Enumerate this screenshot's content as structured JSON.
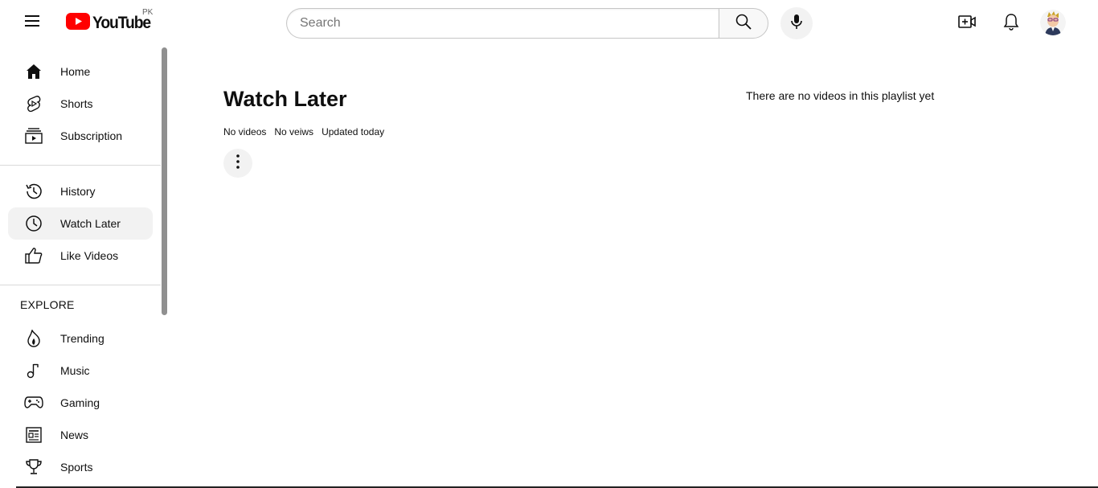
{
  "header": {
    "logo_text": "YouTube",
    "country_code": "PK",
    "search_placeholder": "Search",
    "icons": [
      "menu-icon",
      "search-icon",
      "mic-icon",
      "create-video-icon",
      "bell-icon"
    ]
  },
  "sidebar": {
    "section1": [
      {
        "label": "Home",
        "icon": "home-icon"
      },
      {
        "label": "Shorts",
        "icon": "shorts-icon"
      },
      {
        "label": "Subscription",
        "icon": "subscriptions-icon"
      }
    ],
    "section2": [
      {
        "label": "History",
        "icon": "history-icon"
      },
      {
        "label": "Watch Later",
        "icon": "clock-icon",
        "active": true
      },
      {
        "label": "Like Videos",
        "icon": "thumbs-up-icon"
      }
    ],
    "explore_heading": "EXPLORE",
    "explore": [
      {
        "label": "Trending",
        "icon": "trending-icon"
      },
      {
        "label": "Music",
        "icon": "music-icon"
      },
      {
        "label": "Gaming",
        "icon": "gaming-icon"
      },
      {
        "label": "News",
        "icon": "news-icon"
      },
      {
        "label": "Sports",
        "icon": "trophy-icon"
      }
    ]
  },
  "playlist": {
    "title": "Watch Later",
    "videos": "No videos",
    "views": "No veiws",
    "updated": "Updated today",
    "empty_message": "There are no videos in this playlist yet"
  },
  "colors": {
    "brand_red": "#ff0000",
    "active_bg": "#f2f2f2",
    "text": "#0f0f0f"
  }
}
